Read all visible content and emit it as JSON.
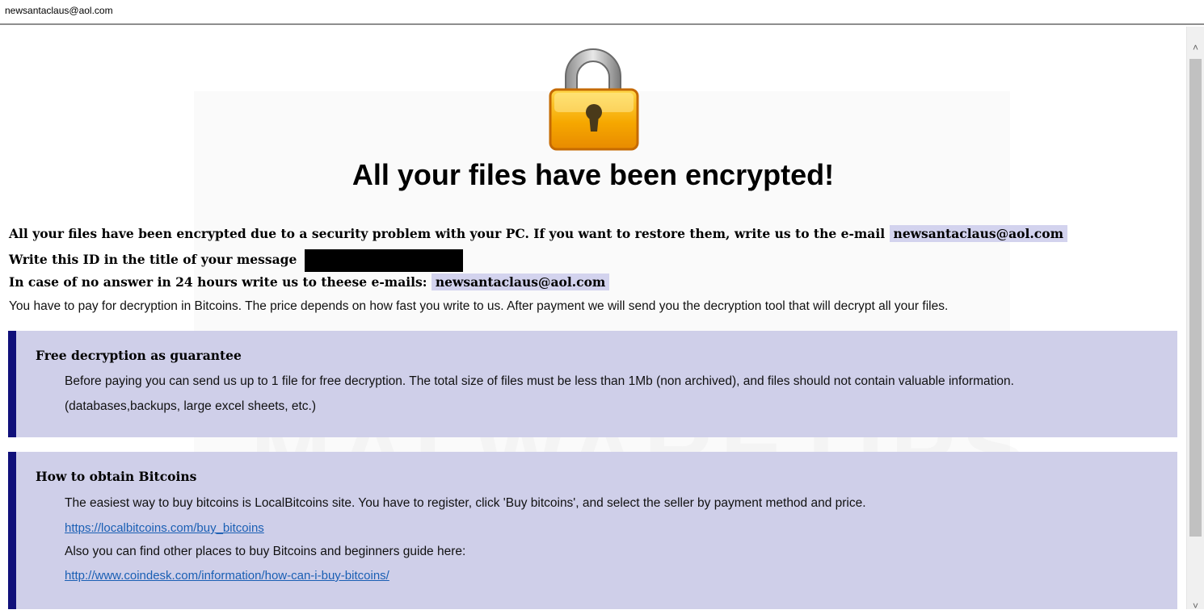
{
  "window": {
    "title": "newsantaclaus@aol.com"
  },
  "note": {
    "heading": "All your files have been encrypted!",
    "line1_text": "All your files have been encrypted due to a security problem with your PC. If you want to restore them, write us to the e-mail",
    "line1_email": "newsantaclaus@aol.com",
    "line2_text": "Write this ID in the title of your message",
    "line3_text": "In case of no answer in 24 hours write us to theese e-mails:",
    "line3_email": "newsantaclaus@aol.com",
    "line4_text": "You have to pay for decryption in Bitcoins. The price depends on how fast you write to us. After payment we will send you the decryption tool that will decrypt all your files."
  },
  "panels": {
    "free": {
      "title": "Free decryption as guarantee",
      "text1": "Before paying you can send us up to 1 file for free decryption. The total size of files must be less than 1Mb (non archived), and files should not contain valuable information.",
      "text2": "(databases,backups, large excel sheets, etc.)"
    },
    "bitcoins": {
      "title": "How to obtain Bitcoins",
      "text1": "The easiest way to buy bitcoins is LocalBitcoins site. You have to register, click 'Buy bitcoins', and select the seller by payment method and price.",
      "link1": "https://localbitcoins.com/buy_bitcoins",
      "text2": "Also you can find other places to buy Bitcoins and beginners guide here:",
      "link2": "http://www.coindesk.com/information/how-can-i-buy-bitcoins/"
    }
  },
  "watermark": "MALWARETIPS",
  "icons": {
    "lock": "padlock-icon",
    "scroll_up": "chevron-up-icon",
    "scroll_down": "chevron-down-icon"
  },
  "colors": {
    "panel_bg": "#cfcfe9",
    "panel_border": "#10107a",
    "email_highlight": "#d3d3ee",
    "link": "#1a5fb4"
  }
}
